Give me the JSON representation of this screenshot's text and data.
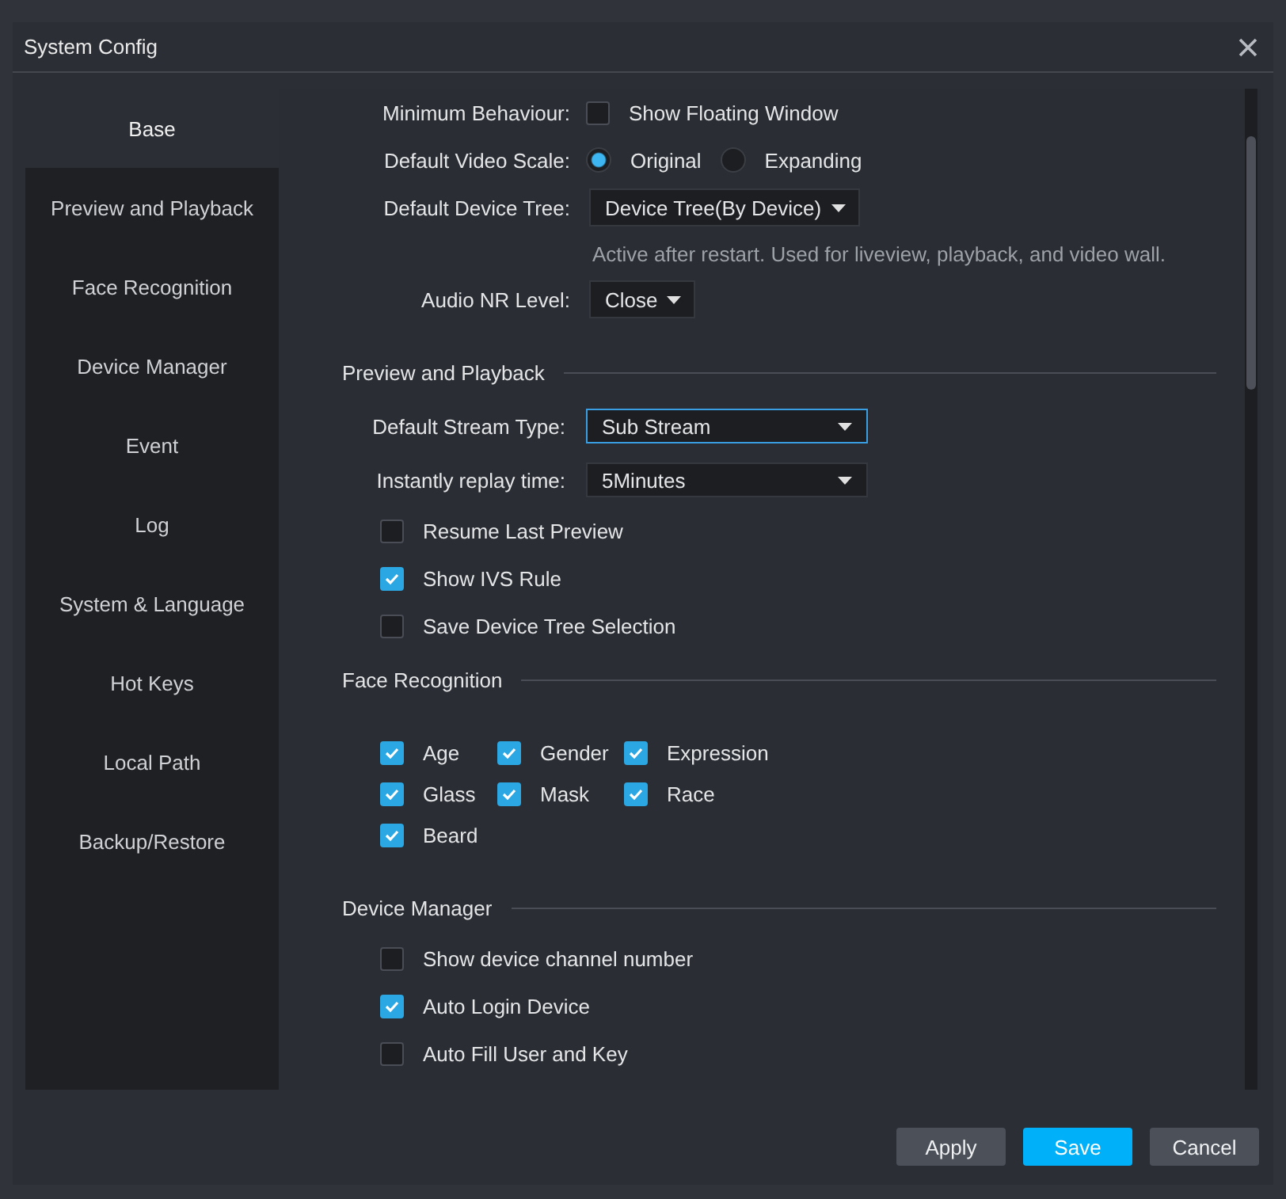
{
  "window": {
    "title": "System Config"
  },
  "sidebar": {
    "items": [
      {
        "label": "Base",
        "selected": true
      },
      {
        "label": "Preview and Playback",
        "selected": false
      },
      {
        "label": "Face Recognition",
        "selected": false
      },
      {
        "label": "Device Manager",
        "selected": false
      },
      {
        "label": "Event",
        "selected": false
      },
      {
        "label": "Log",
        "selected": false
      },
      {
        "label": "System & Language",
        "selected": false
      },
      {
        "label": "Hot Keys",
        "selected": false
      },
      {
        "label": "Local Path",
        "selected": false
      },
      {
        "label": "Backup/Restore",
        "selected": false
      }
    ]
  },
  "base": {
    "rows": [
      {
        "kind": "checkbox",
        "label": "Minimum Behaviour:",
        "option": {
          "label": "Show Floating Window",
          "checked": false
        }
      },
      {
        "kind": "radio",
        "label": "Default Video Scale:",
        "options": [
          {
            "label": "Original",
            "selected": true
          },
          {
            "label": "Expanding",
            "selected": false
          }
        ]
      },
      {
        "kind": "dropdown",
        "label": "Default Device Tree:",
        "value": "Device Tree(By Device)"
      },
      {
        "kind": "note",
        "text": "Active after restart. Used for liveview, playback, and video wall."
      },
      {
        "kind": "dropdown",
        "label": "Audio NR Level:",
        "value": "Close"
      }
    ]
  },
  "sections": [
    {
      "title": "Preview and Playback",
      "items": [
        {
          "kind": "dropdown",
          "label": "Default Stream Type:",
          "value": "Sub Stream",
          "focused": true
        },
        {
          "kind": "dropdown",
          "label": "Instantly replay time:",
          "value": "5Minutes",
          "focused": false
        },
        {
          "kind": "checkbox",
          "label": "Resume Last Preview",
          "checked": false
        },
        {
          "kind": "checkbox",
          "label": "Show IVS Rule",
          "checked": true
        },
        {
          "kind": "checkbox",
          "label": "Save Device Tree Selection",
          "checked": false
        }
      ]
    },
    {
      "title": "Face Recognition",
      "items": [
        {
          "kind": "grid",
          "options": [
            {
              "label": "Age",
              "checked": true
            },
            {
              "label": "Gender",
              "checked": true
            },
            {
              "label": "Expression",
              "checked": true
            },
            {
              "label": "Glass",
              "checked": true
            },
            {
              "label": "Mask",
              "checked": true
            },
            {
              "label": "Race",
              "checked": true
            },
            {
              "label": "Beard",
              "checked": true
            }
          ]
        }
      ]
    },
    {
      "title": "Device Manager",
      "items": [
        {
          "kind": "checkbox",
          "label": "Show device channel number",
          "checked": false
        },
        {
          "kind": "checkbox",
          "label": "Auto Login Device",
          "checked": true
        },
        {
          "kind": "checkbox",
          "label": "Auto Fill User and Key",
          "checked": false
        }
      ]
    }
  ],
  "buttons": [
    {
      "label": "Apply",
      "primary": false
    },
    {
      "label": "Save",
      "primary": true
    },
    {
      "label": "Cancel",
      "primary": false
    }
  ]
}
